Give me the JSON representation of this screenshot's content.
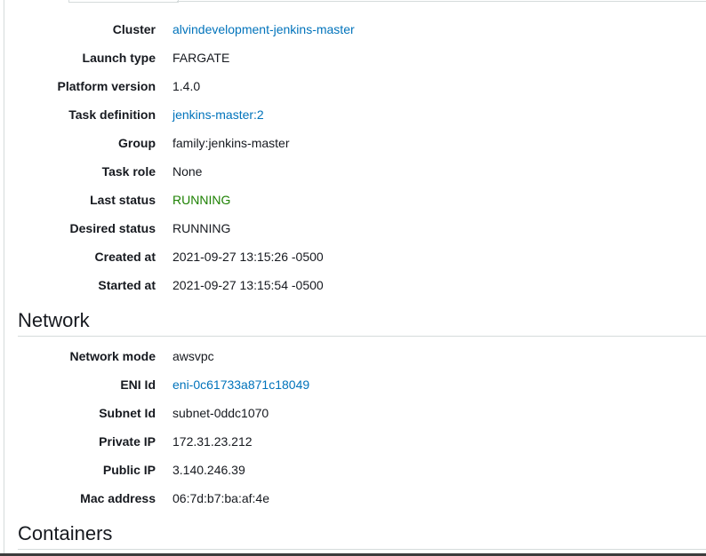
{
  "details": [
    {
      "label": "Cluster",
      "value": "alvindevelopment-jenkins-master",
      "kind": "link"
    },
    {
      "label": "Launch type",
      "value": "FARGATE",
      "kind": "text"
    },
    {
      "label": "Platform version",
      "value": "1.4.0",
      "kind": "text"
    },
    {
      "label": "Task definition",
      "value": "jenkins-master:2",
      "kind": "link"
    },
    {
      "label": "Group",
      "value": "family:jenkins-master",
      "kind": "text"
    },
    {
      "label": "Task role",
      "value": "None",
      "kind": "text"
    },
    {
      "label": "Last status",
      "value": "RUNNING",
      "kind": "status"
    },
    {
      "label": "Desired status",
      "value": "RUNNING",
      "kind": "text"
    },
    {
      "label": "Created at",
      "value": "2021-09-27 13:15:26 -0500",
      "kind": "text"
    },
    {
      "label": "Started at",
      "value": "2021-09-27 13:15:54 -0500",
      "kind": "text"
    }
  ],
  "network": {
    "title": "Network",
    "rows": [
      {
        "label": "Network mode",
        "value": "awsvpc",
        "kind": "text"
      },
      {
        "label": "ENI Id",
        "value": "eni-0c61733a871c18049",
        "kind": "link"
      },
      {
        "label": "Subnet Id",
        "value": "subnet-0ddc1070",
        "kind": "text"
      },
      {
        "label": "Private IP",
        "value": "172.31.23.212",
        "kind": "text"
      },
      {
        "label": "Public IP",
        "value": "3.140.246.39",
        "kind": "text"
      },
      {
        "label": "Mac address",
        "value": "06:7d:b7:ba:af:4e",
        "kind": "text"
      }
    ]
  },
  "containers": {
    "title": "Containers"
  },
  "colors": {
    "link": "#0073bb",
    "running": "#1d8102",
    "text": "#16191f",
    "rule": "#d5dbdb"
  }
}
